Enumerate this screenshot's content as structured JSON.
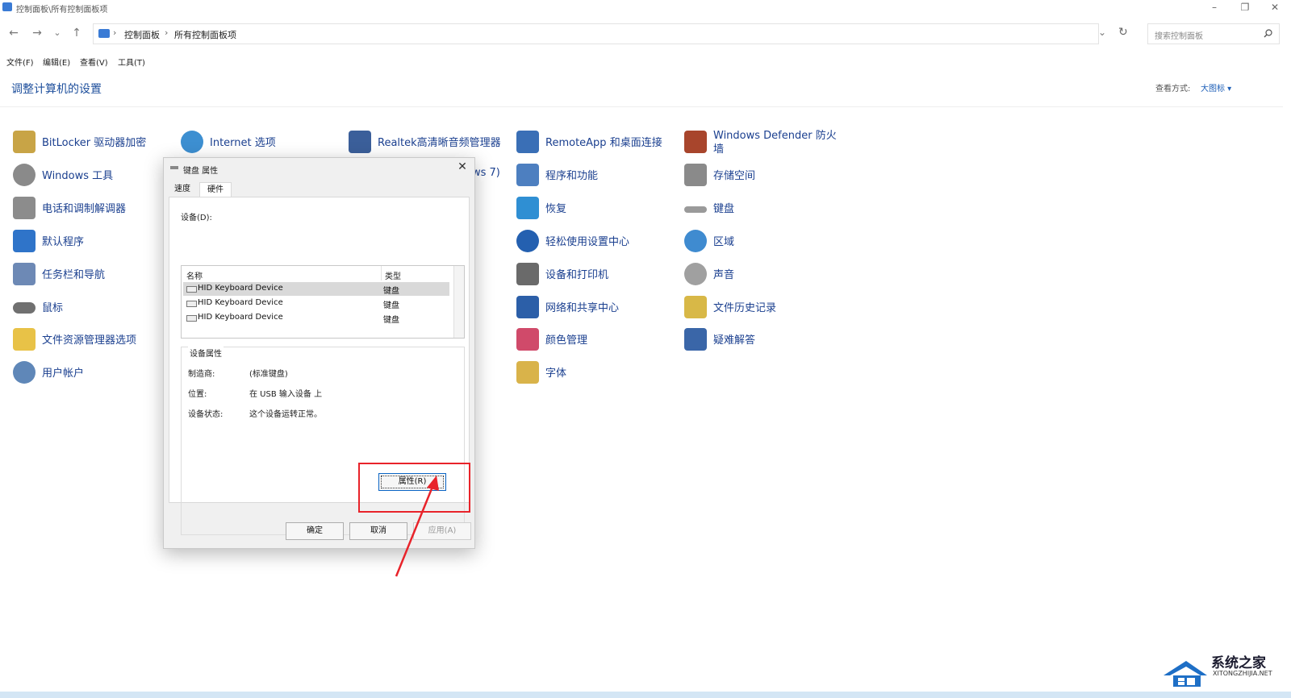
{
  "window": {
    "title": "控制面板\\所有控制面板项",
    "minimize": "–",
    "restore": "❐",
    "close": "✕"
  },
  "nav": {
    "back": "←",
    "forward": "→",
    "recent": "⌄",
    "up": "↑",
    "refresh": "↻",
    "dropdown": "⌄"
  },
  "address": {
    "crumbs": [
      "控制面板",
      "所有控制面板项"
    ],
    "separator": "›"
  },
  "search": {
    "placeholder": "搜索控制面板"
  },
  "menu": [
    "文件(F)",
    "编辑(E)",
    "查看(V)",
    "工具(T)"
  ],
  "header": {
    "title": "调整计算机的设置",
    "view_by_label": "查看方式:",
    "view_by_value": "大图标 ▾"
  },
  "items": [
    {
      "label": "BitLocker 驱动器加密",
      "icon": "bitlocker-icon",
      "color": "#c8a446"
    },
    {
      "label": "Windows 工具",
      "icon": "windows-tools-icon",
      "color": "#8a8a8a"
    },
    {
      "label": "电话和调制解调器",
      "icon": "phone-modem-icon",
      "color": "#8c8c8c"
    },
    {
      "label": "默认程序",
      "icon": "default-programs-icon",
      "color": "#2f74c9"
    },
    {
      "label": "任务栏和导航",
      "icon": "taskbar-icon",
      "color": "#6d89b5"
    },
    {
      "label": "鼠标",
      "icon": "mouse-icon",
      "color": "#707070"
    },
    {
      "label": "文件资源管理器选项",
      "icon": "folder-options-icon",
      "color": "#e8c247"
    },
    {
      "label": "用户帐户",
      "icon": "user-accounts-icon",
      "color": "#5f87b8"
    },
    {
      "label": "Internet 选项",
      "icon": "internet-options-icon",
      "color": "#3d8fd1"
    },
    {
      "label": "Realtek高清晰音频管理器",
      "icon": "realtek-audio-icon",
      "color": "#3b5f9a"
    },
    {
      "label": "ws 7)",
      "icon": "backup-restore-icon",
      "color": "#4a8a4a"
    },
    {
      "label": "RemoteApp 和桌面连接",
      "icon": "remoteapp-icon",
      "color": "#3a6fb6"
    },
    {
      "label": "程序和功能",
      "icon": "programs-features-icon",
      "color": "#4d7fc0"
    },
    {
      "label": "恢复",
      "icon": "recovery-icon",
      "color": "#2f8fd3"
    },
    {
      "label": "轻松使用设置中心",
      "icon": "ease-of-access-icon",
      "color": "#2460b0"
    },
    {
      "label": "设备和打印机",
      "icon": "devices-printers-icon",
      "color": "#6a6a6a"
    },
    {
      "label": "网络和共享中心",
      "icon": "network-sharing-icon",
      "color": "#2c5fa8"
    },
    {
      "label": "颜色管理",
      "icon": "color-management-icon",
      "color": "#d04a6a"
    },
    {
      "label": "字体",
      "icon": "fonts-icon",
      "color": "#d9b34a"
    },
    {
      "label": "Windows Defender 防火",
      "label2": "墙",
      "icon": "firewall-icon",
      "color": "#a8452c"
    },
    {
      "label": "存储空间",
      "icon": "storage-spaces-icon",
      "color": "#8a8a8a"
    },
    {
      "label": "键盘",
      "icon": "keyboard-icon",
      "color": "#9a9a9a"
    },
    {
      "label": "区域",
      "icon": "region-icon",
      "color": "#3f8bd0"
    },
    {
      "label": "声音",
      "icon": "sound-icon",
      "color": "#a0a0a0"
    },
    {
      "label": "文件历史记录",
      "icon": "file-history-icon",
      "color": "#d8b847"
    },
    {
      "label": "疑难解答",
      "icon": "troubleshooting-icon",
      "color": "#3a66a8"
    }
  ],
  "dialog": {
    "title": "键盘 属性",
    "close": "✕",
    "tabs": [
      "速度",
      "硬件"
    ],
    "devices_label": "设备(D):",
    "columns": [
      "名称",
      "类型"
    ],
    "rows": [
      {
        "name": "HID Keyboard Device",
        "type": "键盘"
      },
      {
        "name": "HID Keyboard Device",
        "type": "键盘"
      },
      {
        "name": "HID Keyboard Device",
        "type": "键盘"
      }
    ],
    "group_label": "设备属性",
    "props": [
      {
        "key": "制造商:",
        "value": "(标准键盘)"
      },
      {
        "key": "位置:",
        "value": "在 USB 输入设备 上"
      },
      {
        "key": "设备状态:",
        "value": "这个设备运转正常。"
      }
    ],
    "properties_button": "属性(R)",
    "ok": "确定",
    "cancel": "取消",
    "apply": "应用(A)"
  },
  "annotation_color": "#e8232a",
  "watermark": {
    "title": "系统之家",
    "subtitle": "XITONGZHIJIA.NET"
  }
}
